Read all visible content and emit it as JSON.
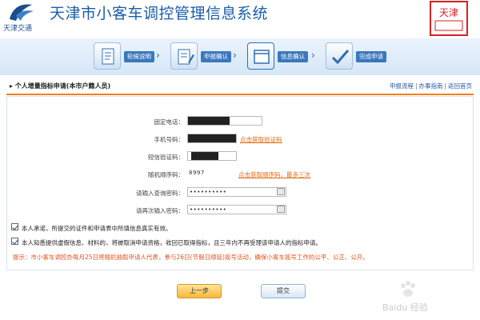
{
  "header": {
    "logo_text": "天津交通",
    "system_title": "天津市小客车调控管理信息系统",
    "seal_text": "天津"
  },
  "steps": [
    {
      "label": "轮候说明",
      "icon": "document-icon"
    },
    {
      "label": "申报确认",
      "icon": "edit-form-icon"
    },
    {
      "label": "信息确认",
      "icon": "window-icon"
    },
    {
      "label": "完成申请",
      "icon": "checkmark-icon"
    }
  ],
  "section": {
    "title": "个人增量指标申请(本市户籍人员)",
    "links": [
      "申报流程",
      "办事指南",
      "返回首页"
    ]
  },
  "form": {
    "phone_label": "固定电话：",
    "mobile_label": "手机号码：",
    "mobile_link": "点击获取验证码",
    "sms_label": "短信验证码：",
    "random_label": "随机顺序码：",
    "random_value": "8997",
    "random_link": "点击获取顺序码，最多三次",
    "query_pw_label": "请输入查询密码：",
    "query_pw_value": "••••••••••",
    "query_pw2_label": "请再次输入密码：",
    "query_pw2_value": "••••••••••"
  },
  "checks": [
    "本人承诺，所提交的证件和申请表中所填信息真实有效。",
    "本人知悉提供虚假信息、材料的，将被取消申请资格，收回已取得指标，且三年内不再受理该申请人的指标申请。"
  ],
  "hint": "提示：市小客车调控办每月25日将随机抽取申请人代表，参与26日(节假日顺延)摇号活动，确保小客车摇号工作的公平、公正、公开。",
  "buttons": {
    "prev": "上一步",
    "submit": "提交"
  },
  "watermark": "Baidu 经验",
  "colors": {
    "title_blue": "#1a5ea8",
    "accent_orange": "#f07f1a",
    "link_orange": "#e06a10",
    "hint_red": "#e0541a"
  }
}
